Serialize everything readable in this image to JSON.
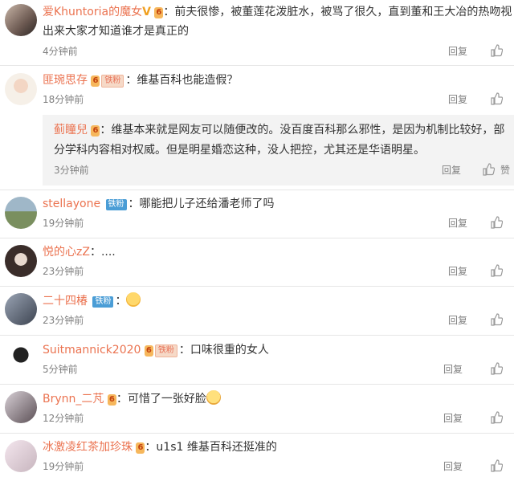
{
  "comments": [
    {
      "name": "爱Khuntoria的魔女",
      "text1": "：前夫很惨，被董莲花泼脏水，被骂了很久，直到董和王大冶的热吻视",
      "text2": "出来大家才知道谁才是真正的",
      "time": "4分钟前",
      "reply": "回复",
      "vip": "6"
    },
    {
      "name": "匪琬思存",
      "text": "：维基百科也能造假？",
      "time": "18分钟前",
      "reply": "回复",
      "vip": "6",
      "badge": "铁粉",
      "sub": {
        "name": "蓟瞳兒",
        "text1": "：维基本来就是网友可以随便改的。没百度百科那么邪性，是因为机制比较好，部",
        "text2": "分学科内容相对权威。但是明星婚恋这种，没人把控，尤其还是华语明星。",
        "time": "3分钟前",
        "reply": "回复",
        "like": "赞",
        "vip": "6"
      }
    },
    {
      "name": "stellayone",
      "text": "：哪能把儿子还给潘老师了吗",
      "time": "19分钟前",
      "reply": "回复",
      "badge": "铁粉"
    },
    {
      "name": "悦的心zZ",
      "text": "：....",
      "time": "23分钟前",
      "reply": "回复"
    },
    {
      "name": "二十四椿",
      "text": "：",
      "time": "23分钟前",
      "reply": "回复",
      "badge": "铁粉"
    },
    {
      "name": "Suitmannick2020",
      "text": "：口味很重的女人",
      "time": "5分钟前",
      "reply": "回复",
      "vip": "6",
      "badge": "铁粉"
    },
    {
      "name": "Brynn_二芃",
      "text": "：可惜了一张好脸",
      "time": "12分钟前",
      "reply": "回复",
      "vip": "6"
    },
    {
      "name": "冰激凌红茶加珍珠",
      "text": "：u1s1 维基百科还挺准的",
      "time": "19分钟前",
      "reply": "回复",
      "vip": "6"
    }
  ]
}
